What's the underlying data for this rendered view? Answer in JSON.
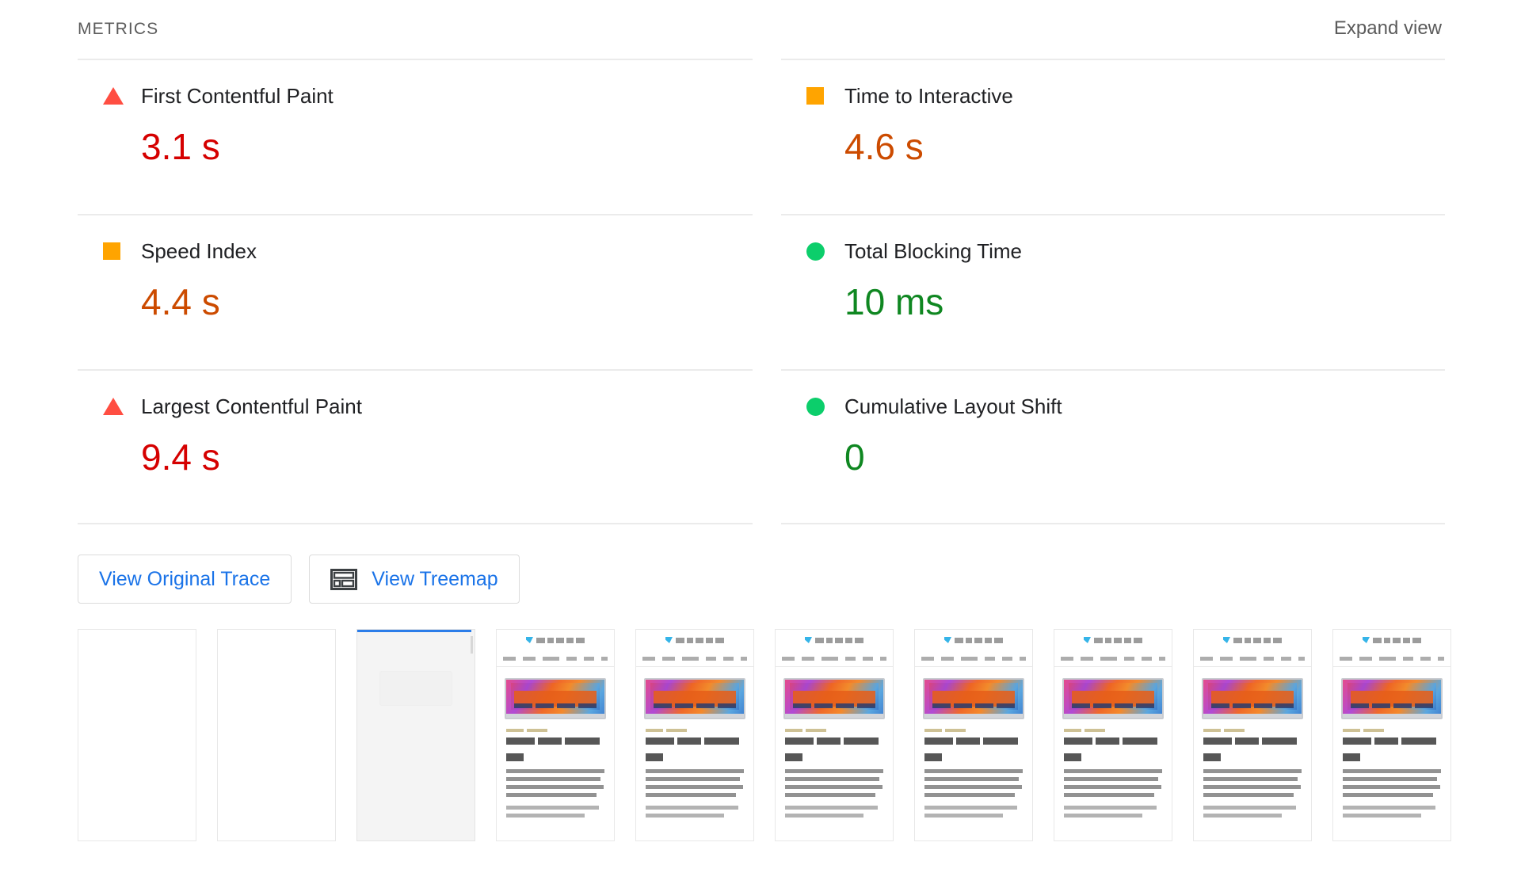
{
  "header": {
    "title": "METRICS",
    "expand_label": "Expand view"
  },
  "metrics": {
    "left": [
      {
        "id": "first-contentful-paint",
        "label": "First Contentful Paint",
        "value": "3.1 s",
        "icon": "triangle-icon",
        "rating": "fail",
        "icon_color": "#ff4e42",
        "value_color": "#d50000"
      },
      {
        "id": "speed-index",
        "label": "Speed Index",
        "value": "4.4 s",
        "icon": "square-icon",
        "rating": "average",
        "icon_color": "#ffa400",
        "value_color": "#cc4b00"
      },
      {
        "id": "largest-contentful-paint",
        "label": "Largest Contentful Paint",
        "value": "9.4 s",
        "icon": "triangle-icon",
        "rating": "fail",
        "icon_color": "#ff4e42",
        "value_color": "#d50000"
      }
    ],
    "right": [
      {
        "id": "time-to-interactive",
        "label": "Time to Interactive",
        "value": "4.6 s",
        "icon": "square-icon",
        "rating": "average",
        "icon_color": "#ffa400",
        "value_color": "#cc4b00"
      },
      {
        "id": "total-blocking-time",
        "label": "Total Blocking Time",
        "value": "10 ms",
        "icon": "circle-icon",
        "rating": "pass",
        "icon_color": "#0cce6b",
        "value_color": "#0f8721"
      },
      {
        "id": "cumulative-layout-shift",
        "label": "Cumulative Layout Shift",
        "value": "0",
        "icon": "circle-icon",
        "rating": "pass",
        "icon_color": "#0cce6b",
        "value_color": "#0f8721"
      }
    ]
  },
  "actions": {
    "view_original_trace": "View Original Trace",
    "view_treemap": "View Treemap",
    "treemap_icon": "treemap-icon",
    "link_color": "#1a73e8"
  },
  "filmstrip": {
    "frames": [
      {
        "id": "frame-1",
        "state": "blank"
      },
      {
        "id": "frame-2",
        "state": "blank"
      },
      {
        "id": "frame-3",
        "state": "loading"
      },
      {
        "id": "frame-4",
        "state": "rendered"
      },
      {
        "id": "frame-5",
        "state": "rendered"
      },
      {
        "id": "frame-6",
        "state": "rendered"
      },
      {
        "id": "frame-7",
        "state": "rendered"
      },
      {
        "id": "frame-8",
        "state": "rendered"
      },
      {
        "id": "frame-9",
        "state": "rendered"
      },
      {
        "id": "frame-10",
        "state": "rendered"
      }
    ]
  }
}
